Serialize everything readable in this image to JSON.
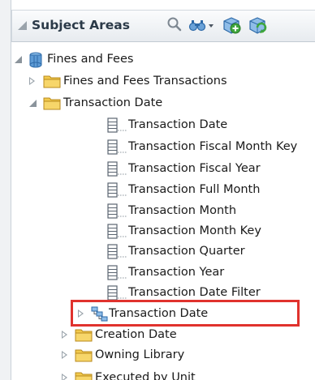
{
  "panel": {
    "title": "Subject Areas",
    "header_icons": [
      "search-icon",
      "filter-icon",
      "add-subject-area-icon",
      "refresh-icon"
    ]
  },
  "tree": {
    "root": {
      "label": "Fines and Fees",
      "icon": "cube-stack-icon",
      "expanded": true
    },
    "folders": [
      {
        "label": "Fines and Fees Transactions",
        "expanded": false
      },
      {
        "label": "Transaction Date",
        "expanded": true
      }
    ],
    "columns": [
      "Transaction Date",
      "Transaction Fiscal Month Key",
      "Transaction Fiscal Year",
      "Transaction Full Month",
      "Transaction Month",
      "Transaction Month Key",
      "Transaction Quarter",
      "Transaction Year",
      "Transaction Date Filter"
    ],
    "hierarchy": {
      "label": "Transaction Date",
      "icon": "hierarchy-icon",
      "expanded": false
    },
    "more_folders": [
      {
        "label": "Creation Date",
        "expanded": false
      },
      {
        "label": "Owning Library",
        "expanded": false
      },
      {
        "label": "Executed by Unit",
        "expanded": false
      }
    ]
  },
  "colors": {
    "highlight": "#e0322d",
    "folder": "#f2c94c",
    "accent": "#2b3a48"
  }
}
